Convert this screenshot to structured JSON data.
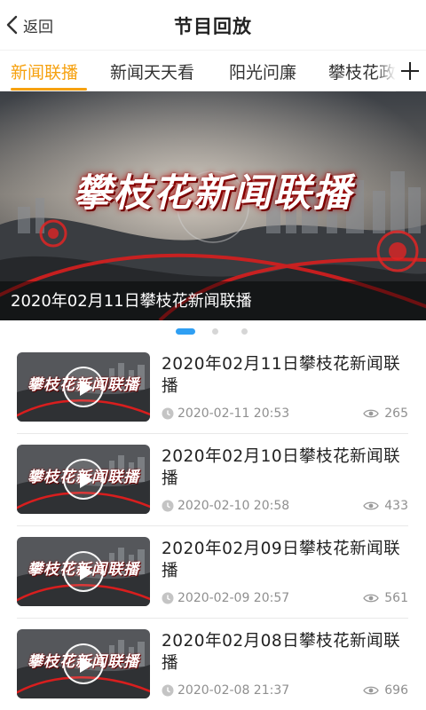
{
  "header": {
    "back_label": "返回",
    "title": "节目回放"
  },
  "tabs": [
    {
      "label": "新闻联播",
      "active": true
    },
    {
      "label": "新闻天天看",
      "active": false
    },
    {
      "label": "阳光问廉",
      "active": false
    },
    {
      "label": "攀枝花政",
      "active": false
    }
  ],
  "banner": {
    "art_title": "攀枝花新闻联播",
    "caption": "2020年02月11日攀枝花新闻联播",
    "page_count": 3,
    "active_page": 1
  },
  "list": [
    {
      "title": "2020年02月11日攀枝花新闻联播",
      "time": "2020-02-11 20:53",
      "views": "265"
    },
    {
      "title": "2020年02月10日攀枝花新闻联播",
      "time": "2020-02-10 20:58",
      "views": "433"
    },
    {
      "title": "2020年02月09日攀枝花新闻联播",
      "time": "2020-02-09 20:57",
      "views": "561"
    },
    {
      "title": "2020年02月08日攀枝花新闻联播",
      "time": "2020-02-08 21:37",
      "views": "696"
    }
  ],
  "thumb_art": "攀枝花新闻联播",
  "colors": {
    "accent": "#f6a10f",
    "dot_active": "#2f9ff3",
    "meta_text": "#8f8f8f"
  },
  "icons": {
    "back": "chevron-left-icon",
    "add_tab": "plus-icon",
    "play": "play-icon",
    "time": "clock-icon",
    "views": "eye-icon"
  }
}
